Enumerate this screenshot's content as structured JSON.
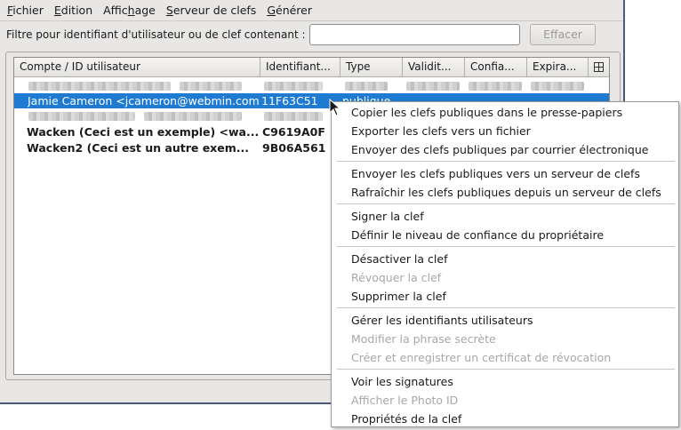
{
  "menubar": {
    "items": [
      {
        "mnemonic": "F",
        "rest": "ichier"
      },
      {
        "mnemonic": "E",
        "rest": "dition"
      },
      {
        "pre": "Affic",
        "mnemonic": "h",
        "rest": "age"
      },
      {
        "mnemonic": "S",
        "rest": "erveur de clefs"
      },
      {
        "mnemonic": "G",
        "rest": "énérer"
      }
    ]
  },
  "filter": {
    "label": "Filtre pour identifiant d'utilisateur ou de clef contenant :",
    "value": "",
    "clear_label": "Effacer"
  },
  "table": {
    "columns": [
      "Compte / ID utilisateur",
      "Identifiant...",
      "Type",
      "Validit...",
      "Confia...",
      "Expira..."
    ],
    "rows": [
      {
        "blurred": true
      },
      {
        "selected": true,
        "user": "Jamie Cameron <jcameron@webmin.com>",
        "id": "11F63C51",
        "type": "publique"
      },
      {
        "blurred": true
      },
      {
        "bold": true,
        "user": "Wacken (Ceci est un exemple) <wa...",
        "id": "C9619A0F"
      },
      {
        "bold": true,
        "user": "Wacken2 (Ceci est un autre exem...",
        "id": "9B06A561"
      }
    ]
  },
  "context_menu": {
    "groups": [
      [
        {
          "label": "Copier les clefs publiques dans le presse-papiers",
          "enabled": true
        },
        {
          "label": "Exporter les clefs vers un fichier",
          "enabled": true
        },
        {
          "label": "Envoyer des clefs publiques par courrier électronique",
          "enabled": true
        }
      ],
      [
        {
          "label": "Envoyer les clefs publiques vers un serveur de clefs",
          "enabled": true
        },
        {
          "label": "Rafraîchir les clefs publiques depuis un serveur de clefs",
          "enabled": true
        }
      ],
      [
        {
          "label": "Signer la clef",
          "enabled": true
        },
        {
          "label": "Définir le niveau de confiance du propriétaire",
          "enabled": true
        }
      ],
      [
        {
          "label": "Désactiver la clef",
          "enabled": true
        },
        {
          "label": "Révoquer la clef",
          "enabled": false
        },
        {
          "label": "Supprimer la clef",
          "enabled": true
        }
      ],
      [
        {
          "label": "Gérer les identifiants utilisateurs",
          "enabled": true
        },
        {
          "label": "Modifier la phrase secrète",
          "enabled": false
        },
        {
          "label": "Créer et enregistrer un certificat de révocation",
          "enabled": false
        }
      ],
      [
        {
          "label": "Voir les signatures",
          "enabled": true
        },
        {
          "label": "Afficher le Photo ID",
          "enabled": false
        },
        {
          "label": "Propriétés de la clef",
          "enabled": true
        }
      ]
    ]
  }
}
